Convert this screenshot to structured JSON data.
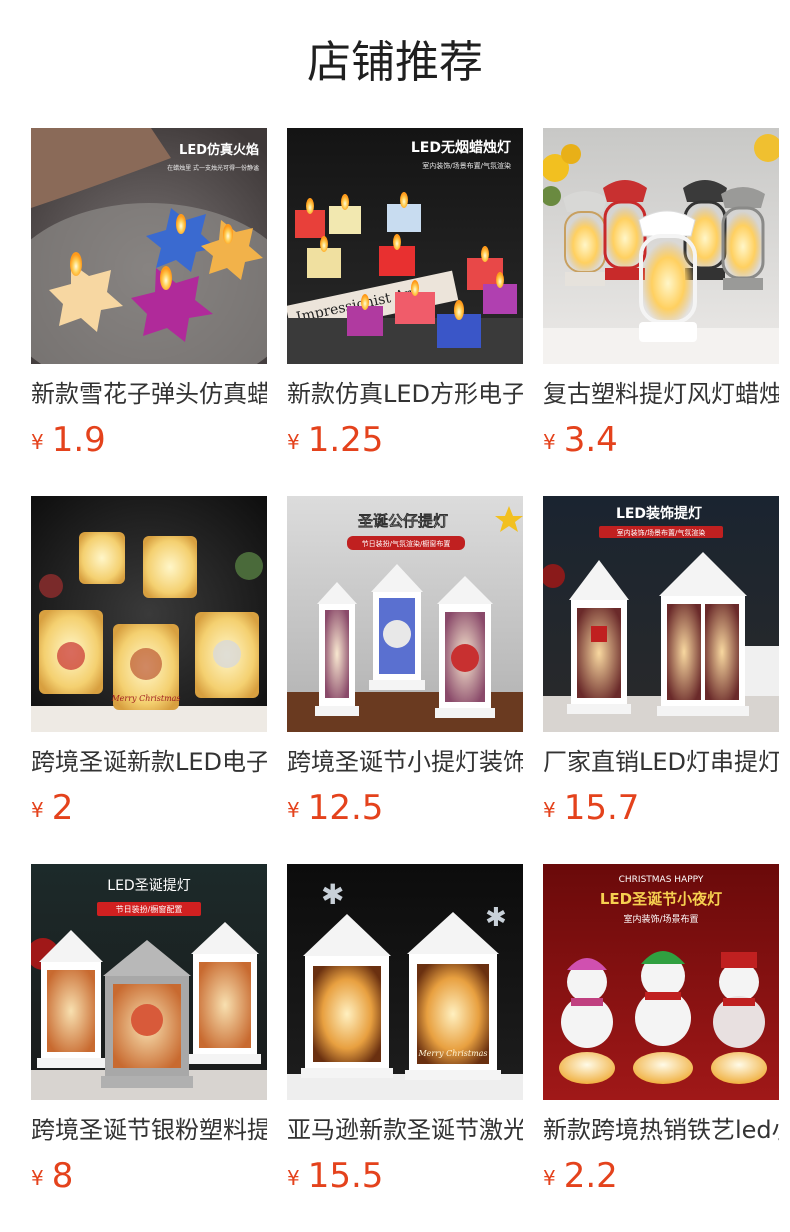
{
  "page_title": "店铺推荐",
  "currency_symbol": "¥",
  "colors": {
    "price": "#e4421c",
    "title": "#1f1f1f",
    "product_name": "#333333"
  },
  "products": [
    {
      "name": "新款雪花子弹头仿真蜡烛",
      "price": "1.9",
      "image_text": [
        "LED仿真火焰",
        "在蜡烛里 式一支烛光可得一份静谧"
      ],
      "image_icon": "snowflake-candle-icon"
    },
    {
      "name": "新款仿真LED方形电子蜡烛",
      "price": "1.25",
      "image_text": [
        "LED无烟蜡烛灯",
        "室内装饰/场景布置/气氛渲染",
        "Impressionist Art"
      ],
      "image_icon": "square-candle-icon"
    },
    {
      "name": "复古塑料提灯风灯蜡烛灯",
      "price": "3.4",
      "image_text": [],
      "image_icon": "oil-lantern-icon"
    },
    {
      "name": "跨境圣诞新款LED电子蜡烛",
      "price": "2",
      "image_text": [
        "Merry Christmas"
      ],
      "image_icon": "christmas-candle-icon"
    },
    {
      "name": "跨境圣诞节小提灯装饰灯",
      "price": "12.5",
      "image_text": [
        "圣诞公仔提灯",
        "节日装扮/气氛渲染/橱窗布置"
      ],
      "image_icon": "christmas-lantern-icon"
    },
    {
      "name": "厂家直销LED灯串提灯风灯",
      "price": "15.7",
      "image_text": [
        "LED装饰提灯",
        "室内装饰/场景布置/气氛渲染"
      ],
      "image_icon": "decorative-lantern-icon"
    },
    {
      "name": "跨境圣诞节银粉塑料提灯",
      "price": "8",
      "image_text": [
        "LED圣诞提灯",
        "节日装扮/橱窗配置"
      ],
      "image_icon": "glitter-lantern-icon"
    },
    {
      "name": "亚马逊新款圣诞节激光提灯",
      "price": "15.5",
      "image_text": [
        "Merry Christmas"
      ],
      "image_icon": "laser-lantern-icon"
    },
    {
      "name": "新款跨境热销铁艺led小夜灯",
      "price": "2.2",
      "image_text": [
        "CHRISTMAS HAPPY",
        "LED圣诞节小夜灯",
        "室内装饰/场景布置"
      ],
      "image_icon": "snowman-night-light-icon"
    }
  ]
}
